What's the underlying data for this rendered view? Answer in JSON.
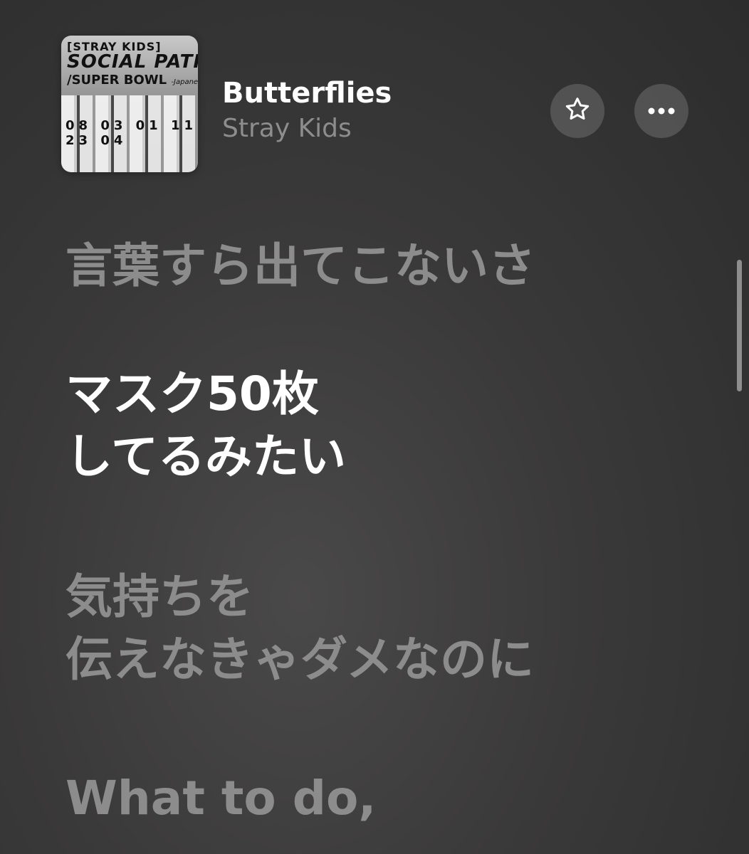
{
  "now_playing": {
    "artwork": {
      "top_text": "[STRAY KIDS]",
      "title_text": "SOCIAL PATH",
      "sub_text": "/SUPER BOWL",
      "edition_text": "-Japanese ver.-",
      "jersey_numbers": "08 03 01 11 23 04"
    },
    "title": "Butterflies",
    "artist": "Stray Kids",
    "favorite_icon": "star-outline-icon",
    "more_icon": "ellipsis-icon"
  },
  "lyrics": [
    {
      "text": "言葉すら出てこないさ",
      "state": "past"
    },
    {
      "text": "マスク50枚\nしてるみたい",
      "state": "active"
    },
    {
      "text": "気持ちを\n伝えなきゃダメなのに",
      "state": "upcoming"
    },
    {
      "text": "What to do,",
      "state": "upcoming"
    }
  ],
  "colors": {
    "active_lyric": "#ffffff",
    "inactive_lyric": "#8c8c8c",
    "artist_text": "#8d8d8d"
  }
}
